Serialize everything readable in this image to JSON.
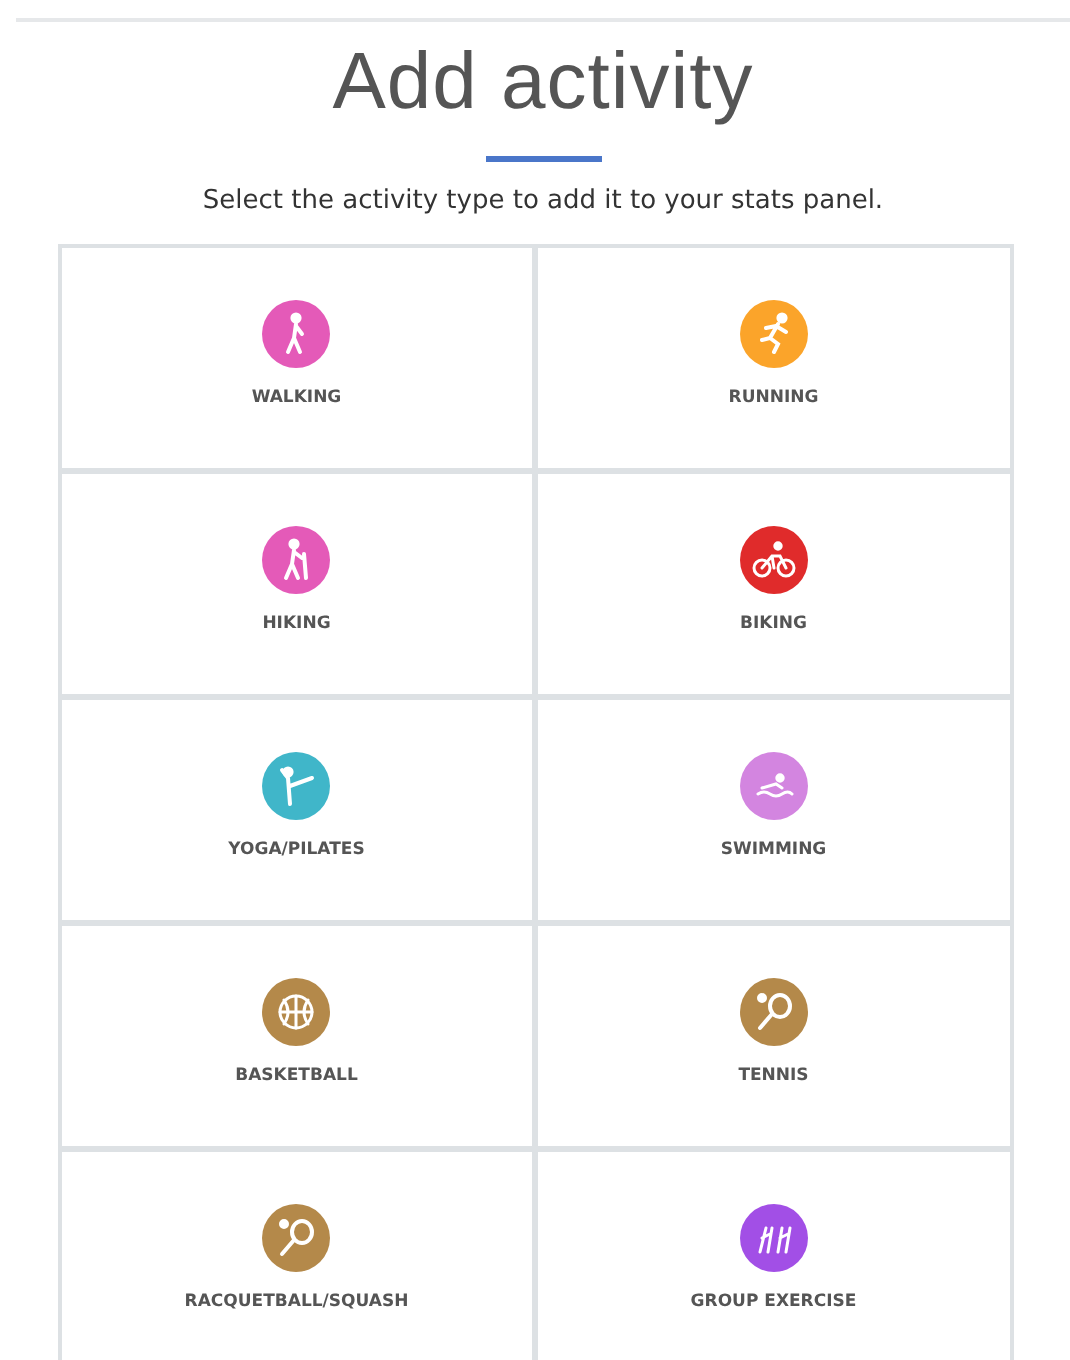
{
  "title": "Add activity",
  "subtitle": "Select the activity type to add it to your stats panel.",
  "activities": [
    {
      "label": "WALKING",
      "kind": "walking",
      "color": "#e45ab8"
    },
    {
      "label": "RUNNING",
      "kind": "running",
      "color": "#fba42a"
    },
    {
      "label": "HIKING",
      "kind": "hiking",
      "color": "#e45ab8"
    },
    {
      "label": "BIKING",
      "kind": "biking",
      "color": "#e02b2b"
    },
    {
      "label": "YOGA/PILATES",
      "kind": "yoga",
      "color": "#40b6c9"
    },
    {
      "label": "SWIMMING",
      "kind": "swimming",
      "color": "#d385e0"
    },
    {
      "label": "BASKETBALL",
      "kind": "basketball",
      "color": "#b4894a"
    },
    {
      "label": "TENNIS",
      "kind": "tennis",
      "color": "#b4894a"
    },
    {
      "label": "RACQUETBALL/SQUASH",
      "kind": "racquetball",
      "color": "#b4894a"
    },
    {
      "label": "GROUP EXERCISE",
      "kind": "group",
      "color": "#a24fe6"
    }
  ]
}
